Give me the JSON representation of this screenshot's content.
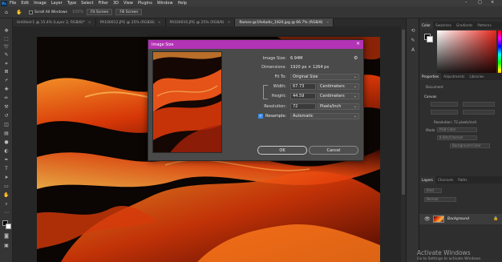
{
  "menubar": {
    "items": [
      "File",
      "Edit",
      "Image",
      "Layer",
      "Type",
      "Select",
      "Filter",
      "3D",
      "View",
      "Plugins",
      "Window",
      "Help"
    ],
    "window_controls": [
      "–",
      "□",
      "×"
    ]
  },
  "options_bar": {
    "scroll_all_label": "Scroll All Windows",
    "fit_screen": "Fit Screen",
    "fill_screen": "Fill Screen"
  },
  "tabs": [
    {
      "label": "Untitled-1 @ 15.4% (Layer 2, RGB/8)*",
      "active": false
    },
    {
      "label": "PA100012.JPG @ 25% (RGB/8)",
      "active": false
    },
    {
      "label": "PA100010.JPG @ 25% (RGB/8)",
      "active": false
    },
    {
      "label": "flames-gc1fe4adic_1920.jpg @ 66.7% (RGB/8)",
      "active": true
    }
  ],
  "tab_close": "×",
  "dialog": {
    "title": "Image Size",
    "image_size_label": "Image Size:",
    "image_size_value": "6.94M",
    "dimensions_label": "Dimensions:",
    "dimensions_value": "1920 px × 1264 px",
    "fit_to_label": "Fit To:",
    "fit_to_value": "Original Size",
    "width_label": "Width:",
    "width_value": "67.73",
    "width_unit": "Centimeters",
    "height_label": "Height:",
    "height_value": "44.59",
    "height_unit": "Centimeters",
    "resolution_label": "Resolution:",
    "resolution_value": "72",
    "resolution_unit": "Pixels/Inch",
    "resample_label": "Resample:",
    "resample_checked": true,
    "resample_value": "Automatic",
    "ok_label": "OK",
    "cancel_label": "Cancel"
  },
  "color_panel": {
    "tabs": [
      "Color",
      "Swatches",
      "Gradients",
      "Patterns"
    ]
  },
  "properties_panel": {
    "tabs": [
      "Properties",
      "Adjustments",
      "Libraries"
    ],
    "doc_label": "Document",
    "canvas_label": "Canvas",
    "resolution_text": "Resolution: 72 pixels/inch",
    "mode_label": "Mode",
    "mode_value": "RGB Color",
    "depth_value": "8 Bits/Channel",
    "fill_value": "Background Color"
  },
  "layers_panel": {
    "tabs": [
      "Layers",
      "Channels",
      "Paths"
    ],
    "kind_label": "Kind",
    "blend_mode": "Normal",
    "layer_name": "Background"
  },
  "watermark": {
    "title": "Activate Windows",
    "subtitle": "Go to Settings to activate Windows."
  },
  "colors": {
    "dialog_title_bar": "#b233b5",
    "app_bg": "#282828"
  }
}
